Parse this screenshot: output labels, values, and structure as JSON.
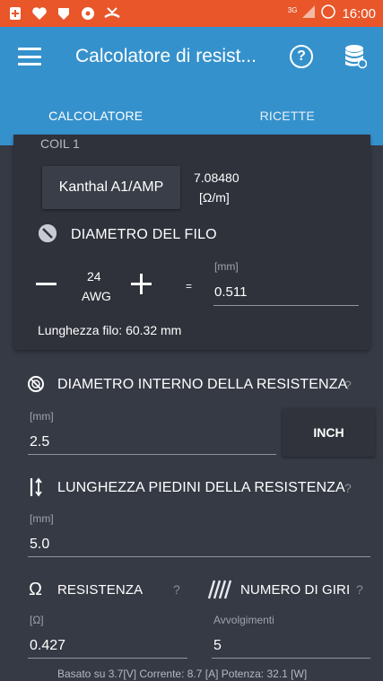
{
  "status_bar": {
    "network": "3G",
    "time": "16:00"
  },
  "app_bar": {
    "title": "Calcolatore di resist...",
    "help_label": "?"
  },
  "tabs": [
    {
      "label": "CALCOLATORE",
      "active": true
    },
    {
      "label": "RICETTE",
      "active": false
    }
  ],
  "coil_card": {
    "peek_label": "COIL 1",
    "material": "Kanthal A1/AMP",
    "resistivity": "7.08480",
    "resistivity_unit": "[Ω/m]",
    "wire_diameter_title": "DIAMETRO DEL FILO",
    "awg_value": "24",
    "awg_unit": "AWG",
    "equals": "=",
    "mm_unit": "[mm]",
    "mm_value": "0.511",
    "wire_length": "Lunghezza filo: 60.32 mm"
  },
  "inner_diameter": {
    "title": "DIAMETRO INTERNO DELLA RESISTENZA",
    "help": "?",
    "unit": "[mm]",
    "value": "2.5",
    "inch_button": "INCH"
  },
  "legs_length": {
    "title": "LUNGHEZZA PIEDINI DELLA RESISTENZA",
    "help": "?",
    "unit": "[mm]",
    "value": "5.0"
  },
  "resistance": {
    "symbol": "Ω",
    "title": "RESISTENZA",
    "help": "?",
    "unit": "[Ω]",
    "value": "0.427"
  },
  "wraps": {
    "title": "NUMERO DI GIRI",
    "help": "?",
    "unit": "Avvolgimenti",
    "value": "5"
  },
  "footer": "Basato su 3.7[V]   Corrente: 8.7 [A]   Potenza: 32.1 [W]",
  "colors": {
    "status_bar": "#e8562a",
    "app_bar": "#3591cc",
    "background": "#363a45",
    "card": "#2f323b"
  }
}
